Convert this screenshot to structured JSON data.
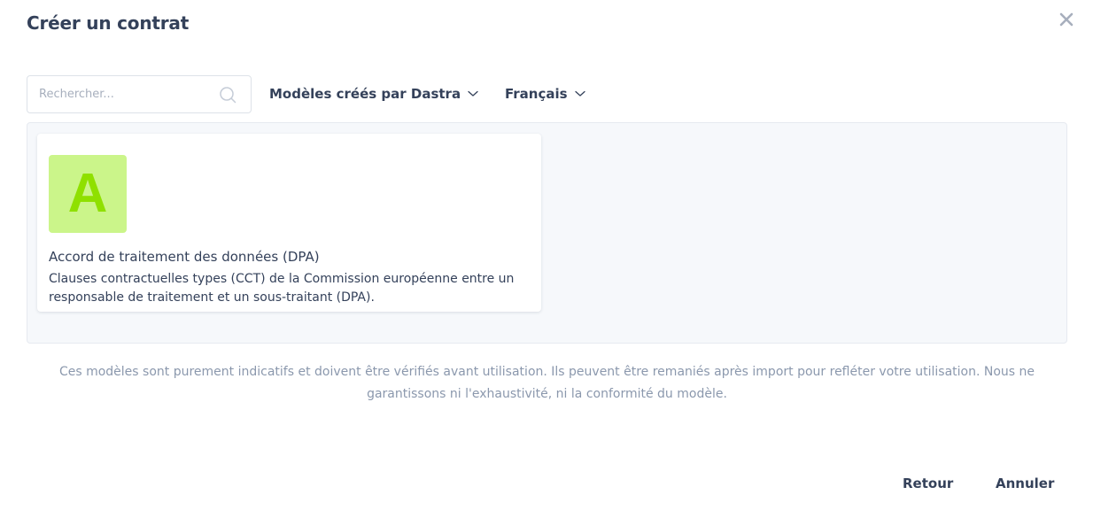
{
  "modal": {
    "title": "Créer un contrat",
    "close_icon": "close-icon"
  },
  "search": {
    "placeholder": "Rechercher...",
    "value": "",
    "icon": "search-icon"
  },
  "filters": {
    "creator": {
      "label": "Modèles créés par Dastra",
      "icon": "chevron-down-icon"
    },
    "language": {
      "label": "Français",
      "icon": "chevron-down-icon"
    }
  },
  "templates": [
    {
      "avatar_letter": "A",
      "avatar_bg": "#cbf58a",
      "avatar_fg": "#8fe000",
      "title": "Accord de traitement des données (DPA)",
      "description": "Clauses contractuelles types (CCT) de la Commission européenne entre un responsable de traitement et un sous-traitant (DPA)."
    }
  ],
  "disclaimer": "Ces modèles sont purement indicatifs et doivent être vérifiés avant utilisation. Ils peuvent être remaniés après import pour refléter votre utilisation. Nous ne garantissons ni l'exhaustivité, ni la conformité du modèle.",
  "footer": {
    "back_label": "Retour",
    "cancel_label": "Annuler"
  },
  "colors": {
    "text": "#34415a",
    "muted": "#8b98ad",
    "panel_bg": "#f6f8fb"
  }
}
